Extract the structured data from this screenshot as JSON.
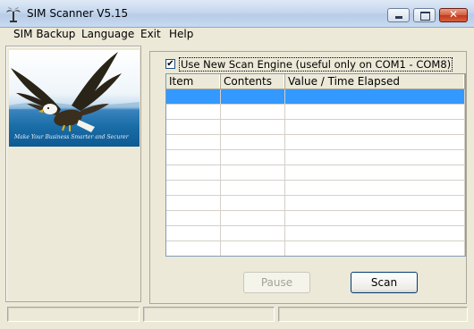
{
  "window": {
    "title": "SIM Scanner V5.15",
    "close_glyph": "✕",
    "icons": {
      "app": "palm-tree-icon",
      "minimize": "minimize-icon",
      "maximize": "maximize-icon",
      "close": "close-icon"
    }
  },
  "menu": [
    "SIM Backup",
    "Language",
    "Exit",
    "Help"
  ],
  "logo": {
    "icon": "eagle-logo",
    "tagline": "Make Your Business Smarter and Securer"
  },
  "options": {
    "use_new_engine_label": "Use New Scan Engine (useful only on COM1 - COM8)",
    "use_new_engine_checked": true,
    "check_glyph": "✔"
  },
  "table": {
    "columns": [
      "Item",
      "Contents",
      "Value / Time Elapsed"
    ],
    "rows": [
      [
        "",
        "",
        ""
      ],
      [
        "",
        "",
        ""
      ],
      [
        "",
        "",
        ""
      ],
      [
        "",
        "",
        ""
      ],
      [
        "",
        "",
        ""
      ],
      [
        "",
        "",
        ""
      ],
      [
        "",
        "",
        ""
      ],
      [
        "",
        "",
        ""
      ],
      [
        "",
        "",
        ""
      ],
      [
        "",
        "",
        ""
      ],
      [
        "",
        "",
        ""
      ]
    ],
    "selected_row": 0
  },
  "buttons": {
    "pause": "Pause",
    "scan": "Scan",
    "pause_enabled": false
  },
  "statusbar": {
    "panes": [
      "",
      "",
      ""
    ]
  },
  "colors": {
    "selection": "#3399ff",
    "window_bg": "#ece9d8",
    "title_close": "#c2391a"
  }
}
